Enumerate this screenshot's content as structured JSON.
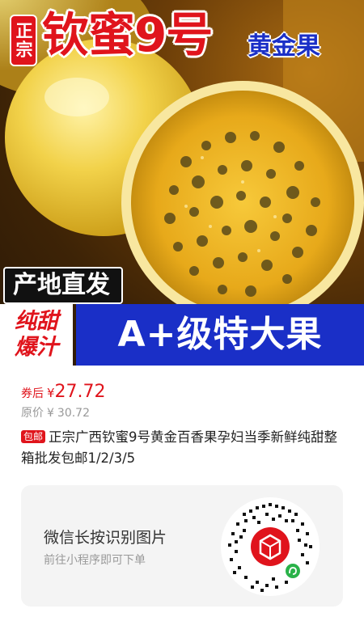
{
  "hero": {
    "badge": "正宗",
    "title": "钦蜜9号",
    "subtitle": "黄金果",
    "origin_tag": "产地直发",
    "sweet_label_line1": "纯甜",
    "sweet_label_line2": "爆汁",
    "grade_label": "A+级特大果"
  },
  "price": {
    "prefix": "券后",
    "currency": "¥",
    "value": "27.72",
    "original_label": "原价",
    "original_currency": "¥",
    "original_value": "30.72"
  },
  "product": {
    "tag": "包邮",
    "title": "正宗广西钦蜜9号黄金百香果孕妇当季新鲜纯甜整箱批发包邮1/2/3/5"
  },
  "qr_card": {
    "main_text": "微信长按识别图片",
    "sub_text": "前往小程序即可下单",
    "logo_icon": "pinduoduo-logo-icon",
    "mini_program_icon": "wechat-mini-program-icon"
  },
  "colors": {
    "brand_red": "#e0141c",
    "brand_blue": "#1a2fc7",
    "muted_gray": "#999999"
  }
}
